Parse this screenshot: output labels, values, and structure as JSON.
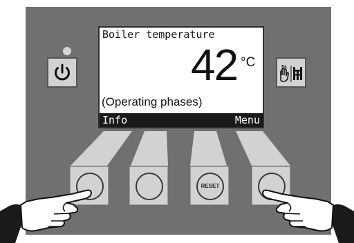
{
  "display": {
    "title": "Boiler temperature",
    "temperature": "42",
    "unit": "°C",
    "status": "(Operating phases)",
    "softkey_left": "Info",
    "softkey_right": "Menu"
  },
  "keys": {
    "reset_label": "RESET"
  },
  "icons": {
    "power": "power-icon",
    "service": "chimney-sweep-service-icon"
  },
  "colors": {
    "panel": "#707070",
    "button": "#d2d2d2",
    "screen": "#ffffff",
    "softkey_bar": "#1a1a1a"
  }
}
